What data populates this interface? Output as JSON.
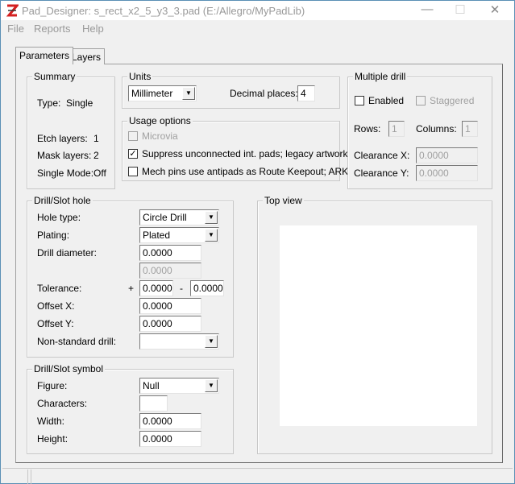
{
  "window": {
    "title": "Pad_Designer: s_rect_x2_5_y3_3.pad (E:/Allegro/MyPadLib)",
    "minimize": "—",
    "maximize": "☐",
    "close": "✕"
  },
  "menu": [
    "File",
    "Reports",
    "Help"
  ],
  "tabs": [
    {
      "label": "Parameters",
      "active": true
    },
    {
      "label": "Layers",
      "active": false
    }
  ],
  "summary": {
    "title": "Summary",
    "type_label": "Type:",
    "type_value": "Single",
    "etch_label": "Etch layers:",
    "etch_value": "1",
    "mask_label": "Mask layers:",
    "mask_value": "2",
    "mode_label": "Single Mode:",
    "mode_value": "Off"
  },
  "units": {
    "title": "Units",
    "selected": "Millimeter",
    "decimal_label": "Decimal places:",
    "decimal_value": "4"
  },
  "usage": {
    "title": "Usage options",
    "microvia": {
      "label": "Microvia",
      "checked": false,
      "enabled": false
    },
    "suppress": {
      "label": "Suppress unconnected int. pads; legacy artwork",
      "checked": true
    },
    "mech": {
      "label": "Mech pins use antipads as Route Keepout; ARK",
      "checked": false
    }
  },
  "multiple_drill": {
    "title": "Multiple drill",
    "enabled_label": "Enabled",
    "staggered_label": "Staggered",
    "rows_label": "Rows:",
    "rows_value": "1",
    "columns_label": "Columns:",
    "columns_value": "1",
    "clearance_x_label": "Clearance X:",
    "clearance_x_value": "0.0000",
    "clearance_y_label": "Clearance Y:",
    "clearance_y_value": "0.0000"
  },
  "drill_hole": {
    "title": "Drill/Slot hole",
    "hole_type_label": "Hole type:",
    "hole_type_value": "Circle Drill",
    "plating_label": "Plating:",
    "plating_value": "Plated",
    "diameter_label": "Drill diameter:",
    "diameter_value": "0.0000",
    "diameter2_value": "0.0000",
    "tolerance_label": "Tolerance:",
    "plus": "+",
    "minus": "-",
    "tol_plus_value": "0.0000",
    "tol_minus_value": "0.0000",
    "offset_x_label": "Offset X:",
    "offset_x_value": "0.0000",
    "offset_y_label": "Offset Y:",
    "offset_y_value": "0.0000",
    "nonstd_label": "Non-standard drill:",
    "nonstd_value": ""
  },
  "drill_symbol": {
    "title": "Drill/Slot symbol",
    "figure_label": "Figure:",
    "figure_value": "Null",
    "characters_label": "Characters:",
    "characters_value": "",
    "width_label": "Width:",
    "width_value": "0.0000",
    "height_label": "Height:",
    "height_value": "0.0000"
  },
  "top_view": {
    "title": "Top view"
  },
  "colors": {
    "logo": "#d42020",
    "title_text": "#999999"
  }
}
